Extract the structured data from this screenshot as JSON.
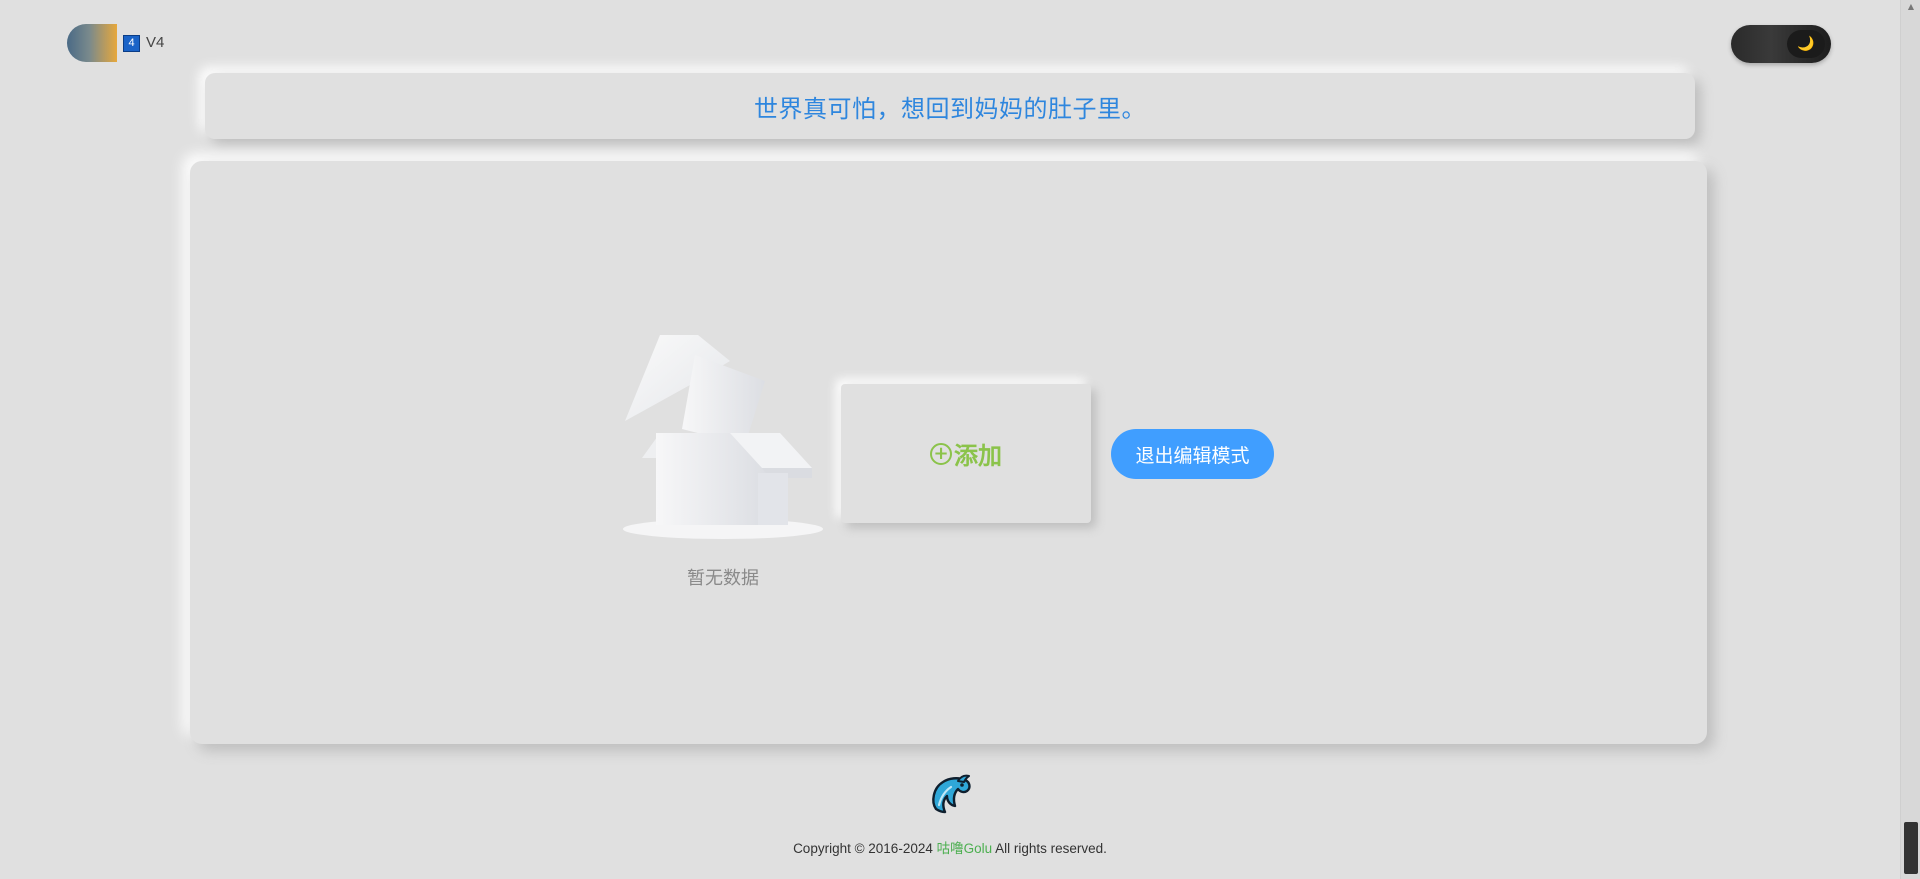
{
  "header": {
    "version_badge": "4",
    "version_label": "V4",
    "theme_icon": "moon-icon",
    "theme_icon_glyph": "🌙"
  },
  "banner": {
    "slogan": "世界真可怕，想回到妈妈的肚子里。"
  },
  "main": {
    "empty_text": "暂无数据",
    "add_icon_glyph": "+",
    "add_label": "添加",
    "exit_button_label": "退出编辑模式"
  },
  "footer": {
    "copyright_prefix": "Copyright © 2016-2024 ",
    "brand": "咕噜Golu",
    "copyright_suffix": " All rights reserved."
  },
  "colors": {
    "background": "#e0e0e0",
    "slogan": "#2e86de",
    "add_accent": "#8bc34a",
    "primary_button": "#409eff",
    "brand_link": "#4caf50"
  }
}
